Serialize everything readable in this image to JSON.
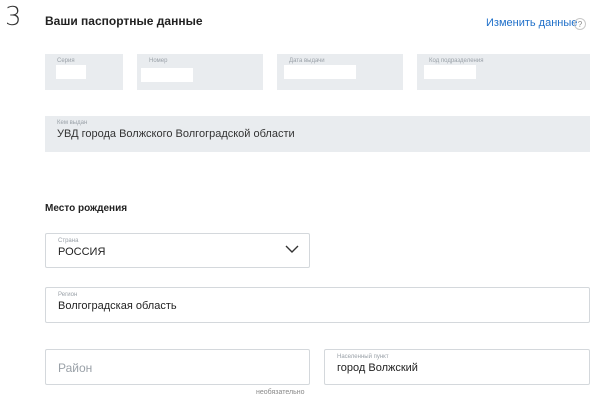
{
  "step": {
    "number": "3"
  },
  "header": {
    "title": "Ваши паспортные данные",
    "edit_link": "Изменить данные",
    "help_icon": "?"
  },
  "passport": {
    "series_label": "Серия",
    "number_label": "Номер",
    "issue_date_label": "Дата выдачи",
    "dept_code_label": "Код подразделения",
    "issued_by_label": "Кем выдан",
    "issued_by_value": "УВД города Волжского Волгоградской области"
  },
  "birthplace": {
    "section_title": "Место рождения",
    "country_label": "Страна",
    "country_value": "РОССИЯ",
    "region_label": "Регион",
    "region_value": "Волгоградская область",
    "district_placeholder": "Район",
    "district_note": "необязательно",
    "locality_label": "Населенный пункт",
    "locality_value": "город Волжский"
  },
  "colors": {
    "accent": "#1e6fc9",
    "field_gray": "#e9ecef",
    "border": "#d4d8dc"
  }
}
